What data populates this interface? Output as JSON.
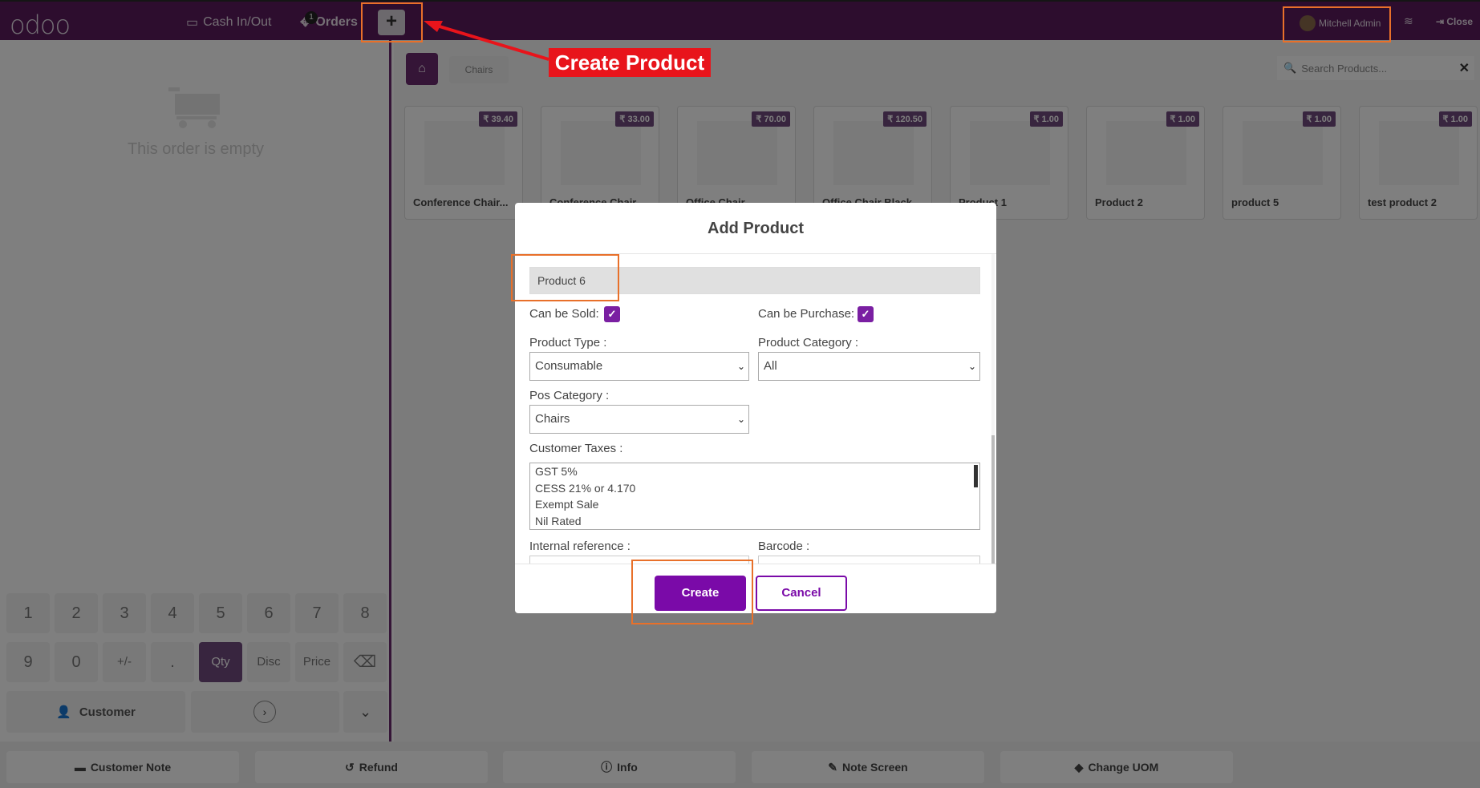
{
  "topbar": {
    "logo": "odoo",
    "cash_in_out": "Cash In/Out",
    "orders": "Orders",
    "orders_badge": "1",
    "plus": "+",
    "user_name": "Mitchell Admin",
    "close": "Close",
    "brand_color": "#5a1a5c"
  },
  "left": {
    "empty_message": "This order is empty",
    "keys": [
      "1",
      "2",
      "3",
      "4",
      "5",
      "6",
      "7",
      "8",
      "9",
      "0",
      "+/-",
      ".",
      "Qty",
      "Disc",
      "Price",
      "⌫"
    ],
    "customer": "Customer"
  },
  "products": {
    "breadcrumb": "Chairs",
    "search_placeholder": "Search Products...",
    "items": [
      {
        "name": "Conference Chair...",
        "price": "₹ 39.40"
      },
      {
        "name": "Conference Chair",
        "price": "₹ 33.00"
      },
      {
        "name": "Office Chair",
        "price": "₹ 70.00"
      },
      {
        "name": "Office Chair Black",
        "price": "₹ 120.50"
      },
      {
        "name": "Product 1",
        "price": "₹ 1.00"
      },
      {
        "name": "Product 2",
        "price": "₹ 1.00"
      },
      {
        "name": "product 5",
        "price": "₹ 1.00"
      },
      {
        "name": "test product 2",
        "price": "₹ 1.00"
      }
    ]
  },
  "bottom": {
    "customer_note": "Customer Note",
    "refund": "Refund",
    "info": "Info",
    "note_screen": "Note Screen",
    "change_uom": "Change UOM"
  },
  "modal": {
    "title": "Add Product",
    "product_name": "Product 6",
    "can_be_sold_label": "Can be Sold:",
    "can_be_sold": true,
    "can_be_purchase_label": "Can be Purchase:",
    "can_be_purchase": true,
    "product_type_label": "Product Type :",
    "product_type": "Consumable",
    "product_category_label": "Product Category :",
    "product_category": "All",
    "pos_category_label": "Pos Category :",
    "pos_category": "Chairs",
    "customer_taxes_label": "Customer Taxes :",
    "customer_taxes": [
      "GST 5%",
      "CESS 21% or 4.170",
      "Exempt Sale",
      "Nil Rated"
    ],
    "internal_reference_label": "Internal reference :",
    "barcode_label": "Barcode :",
    "create": "Create",
    "cancel": "Cancel",
    "accent_color": "#7a0aa8"
  },
  "annotation": {
    "callout": "Create Product",
    "callout_color": "#e8141b",
    "highlight_color": "#e8702a"
  }
}
